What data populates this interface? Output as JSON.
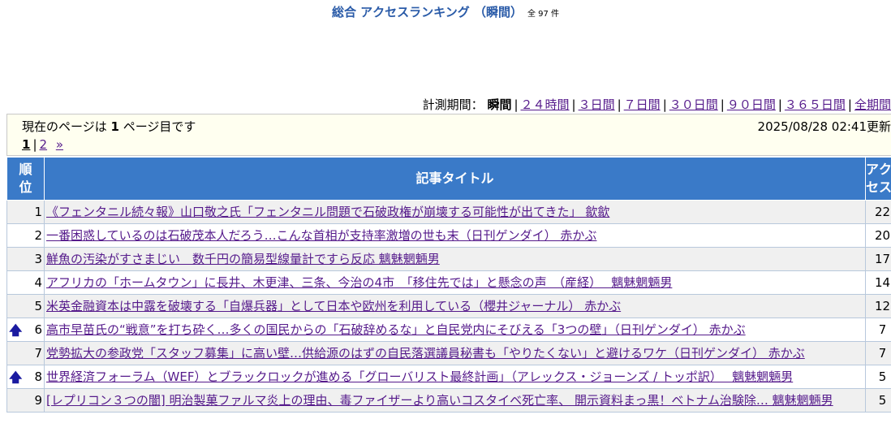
{
  "header": {
    "title": "総合 アクセスランキング （瞬間）",
    "total": "全 97 件"
  },
  "period": {
    "label": "計測期間：",
    "current": "瞬間",
    "links": [
      "２４時間",
      "３日間",
      "７日間",
      "３０日間",
      "９０日間",
      "３６５日間",
      "全期間"
    ]
  },
  "pageinfo": {
    "current_text_pre": "現在のページは",
    "current_page": "1",
    "current_text_post": "ページ目です",
    "updated": "2025/08/28 02:41更新",
    "pager_current": "1",
    "pager_next_page": "2",
    "pager_next": "»",
    "sep": "|"
  },
  "table": {
    "col_rank": "順位",
    "col_title": "記事タイトル",
    "col_access": "アクセス",
    "rows": [
      {
        "rank": "1",
        "title": "《フェンタニル続々報》山口敬之氏「フェンタニル問題で石破政権が崩壊する可能性が出てきた」 歙歙",
        "access": "22",
        "up": ""
      },
      {
        "rank": "2",
        "title": "一番困惑しているのは石破茂本人だろう…こんな首相が支持率激増の世も末（日刊ゲンダイ） 赤かぶ",
        "access": "20",
        "up": ""
      },
      {
        "rank": "3",
        "title": "鮮魚の汚染がすさまじい　数千円の簡易型線量計ですら反応 魑魅魍魎男",
        "access": "17",
        "up": ""
      },
      {
        "rank": "4",
        "title": "アフリカの「ホームタウン」に長井、木更津、三条、今治の4市　「移住先では」と懸念の声　（産経）　 魑魅魍魎男",
        "access": "14",
        "up": ""
      },
      {
        "rank": "5",
        "title": "米英金融資本は中露を破壊する「自爆兵器」として日本や欧州を利用している（櫻井ジャーナル） 赤かぶ",
        "access": "12",
        "up": ""
      },
      {
        "rank": "6",
        "title": "高市早苗氏の“戦意”を打ち砕く…多くの国民からの「石破辞めるな」と自民党内にそびえる「3つの壁」（日刊ゲンダイ） 赤かぶ",
        "access": "7",
        "up": "🡅"
      },
      {
        "rank": "7",
        "title": "党勢拡大の参政党「スタッフ募集」に高い壁…供給源のはずの自民落選議員秘書も「やりたくない」と避けるワケ（日刊ゲンダイ） 赤かぶ",
        "access": "7",
        "up": ""
      },
      {
        "rank": "8",
        "title": "世界経済フォーラム（WEF）とブラックロックが進める「グローバリスト最終計画」（アレックス・ジョーンズ / トッポ訳）　 魑魅魍魎男",
        "access": "5",
        "up": "🡅"
      },
      {
        "rank": "9",
        "title": "[レプリコン３つの闇] 明治製菓ファルマ炎上の理由、毒ファイザーより高いコスタイベ死亡率、 開示資料まっ黒！ベトナム治験除… 魑魅魍魎男",
        "access": "5",
        "up": ""
      }
    ]
  }
}
